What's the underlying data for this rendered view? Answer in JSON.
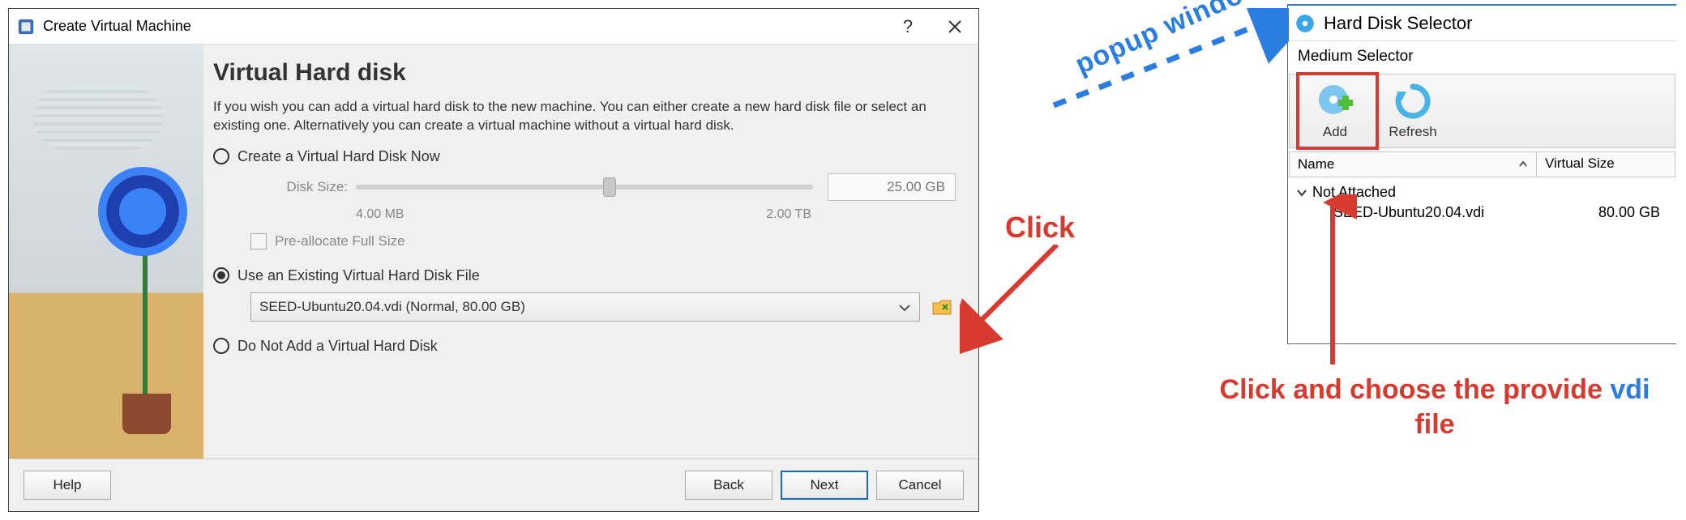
{
  "wizard": {
    "title": "Create Virtual Machine",
    "heading": "Virtual Hard disk",
    "description": "If you wish you can add a virtual hard disk to the new machine. You can either create a new hard disk file or select an existing one. Alternatively you can create a virtual machine without a virtual hard disk.",
    "options": {
      "create_now": "Create a Virtual Hard Disk Now",
      "use_existing": "Use an Existing Virtual Hard Disk File",
      "do_not_add": "Do Not Add a Virtual Hard Disk"
    },
    "disk_size_label": "Disk Size:",
    "disk_size_value": "25.00 GB",
    "scale_min": "4.00 MB",
    "scale_max": "2.00 TB",
    "preallocate_label": "Pre-allocate Full Size",
    "selected_file": "SEED-Ubuntu20.04.vdi (Normal, 80.00 GB)",
    "buttons": {
      "help": "Help",
      "back": "Back",
      "next": "Next",
      "cancel": "Cancel"
    }
  },
  "popup": {
    "title": "Hard Disk Selector",
    "subtitle": "Medium Selector",
    "tools": {
      "add": "Add",
      "refresh": "Refresh"
    },
    "columns": {
      "name": "Name",
      "vsize": "Virtual Size"
    },
    "group": "Not Attached",
    "item": {
      "name": "SEED-Ubuntu20.04.vdi",
      "size": "80.00 GB"
    }
  },
  "annotations": {
    "click": "Click",
    "popup_window": "popup window",
    "choose_pre": "Click and choose the provide ",
    "choose_em": "vdi",
    "choose_post": " file"
  }
}
